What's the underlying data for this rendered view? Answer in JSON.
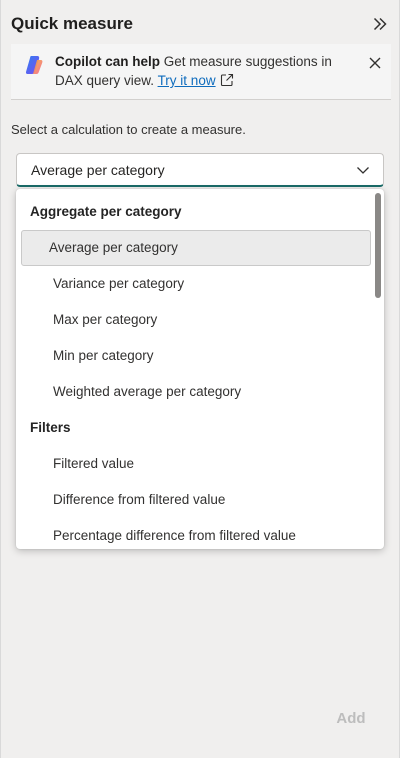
{
  "header": {
    "title": "Quick measure"
  },
  "banner": {
    "heading": "Copilot can help",
    "body": "Get measure suggestions in DAX query view.",
    "link_text": "Try it now"
  },
  "prompt": "Select a calculation to create a measure.",
  "select": {
    "value": "Average per category"
  },
  "dropdown": {
    "groups": [
      {
        "label": "Aggregate per category",
        "options": [
          "Average per category",
          "Variance per category",
          "Max per category",
          "Min per category",
          "Weighted average per category"
        ]
      },
      {
        "label": "Filters",
        "options": [
          "Filtered value",
          "Difference from filtered value",
          "Percentage difference from filtered value"
        ]
      }
    ],
    "selected_option": "Average per category"
  },
  "footer": {
    "add_label": "Add"
  },
  "colors": {
    "accent": "#1a6b68",
    "link": "#0f6cbd",
    "disabled_text": "#bdbdbd"
  }
}
